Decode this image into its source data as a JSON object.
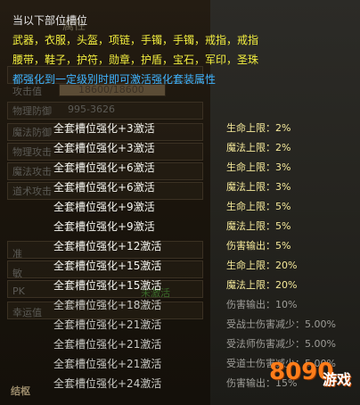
{
  "tooltip": {
    "line1": "当以下部位槽位",
    "line2": "武器，衣服，头盔，项链，手镯，手镯，戒指，戒指",
    "line3": "腰带，鞋子，护符，勋章，护盾，宝石，军印，圣珠",
    "line4": "都强化到一定级别时即可激活强化套装属性"
  },
  "background": {
    "heading": "属性",
    "attack_label": "攻击值",
    "attack_value": "18600/18600",
    "phys_def_label": "物理防御",
    "phys_def_value": "995-3626",
    "rows": [
      "魔法防御",
      "物理攻击",
      "魔法攻击",
      "道术攻击"
    ],
    "lower_labels": [
      "准",
      "敏",
      "PK",
      "幸运值"
    ],
    "level_text": "未激活",
    "footer": "结枢"
  },
  "bonuses": [
    {
      "condition": "全套槽位强化+3激活",
      "effect": "生命上限：2%"
    },
    {
      "condition": "全套槽位强化+3激活",
      "effect": "魔法上限：2%"
    },
    {
      "condition": "全套槽位强化+6激活",
      "effect": "生命上限：3%"
    },
    {
      "condition": "全套槽位强化+6激活",
      "effect": "魔法上限：3%"
    },
    {
      "condition": "全套槽位强化+9激活",
      "effect": "生命上限：5%"
    },
    {
      "condition": "全套槽位强化+9激活",
      "effect": "魔法上限：5%"
    },
    {
      "condition": "全套槽位强化+12激活",
      "effect": "伤害输出：5%"
    },
    {
      "condition": "全套槽位强化+15激活",
      "effect": "生命上限：20%"
    },
    {
      "condition": "全套槽位强化+15激活",
      "effect": "魔法上限：20%"
    },
    {
      "condition": "全套槽位强化+18激活",
      "effect": "伤害输出：10%"
    },
    {
      "condition": "全套槽位强化+21激活",
      "effect": "受战士伤害减少：5.00%"
    },
    {
      "condition": "全套槽位强化+21激活",
      "effect": "受法师伤害减少：5.00%"
    },
    {
      "condition": "全套槽位强化+21激活",
      "effect": "受道士伤害减少：5.00%"
    },
    {
      "condition": "全套槽位强化+24激活",
      "effect": "伤害输出：15%"
    }
  ],
  "watermark": {
    "number": "8090",
    "text": "游戏"
  },
  "colors": {
    "white": "#e6e6e6",
    "yellow": "#f3ef3f",
    "blue": "#3fb4ff",
    "effect": "#f5e99a"
  }
}
